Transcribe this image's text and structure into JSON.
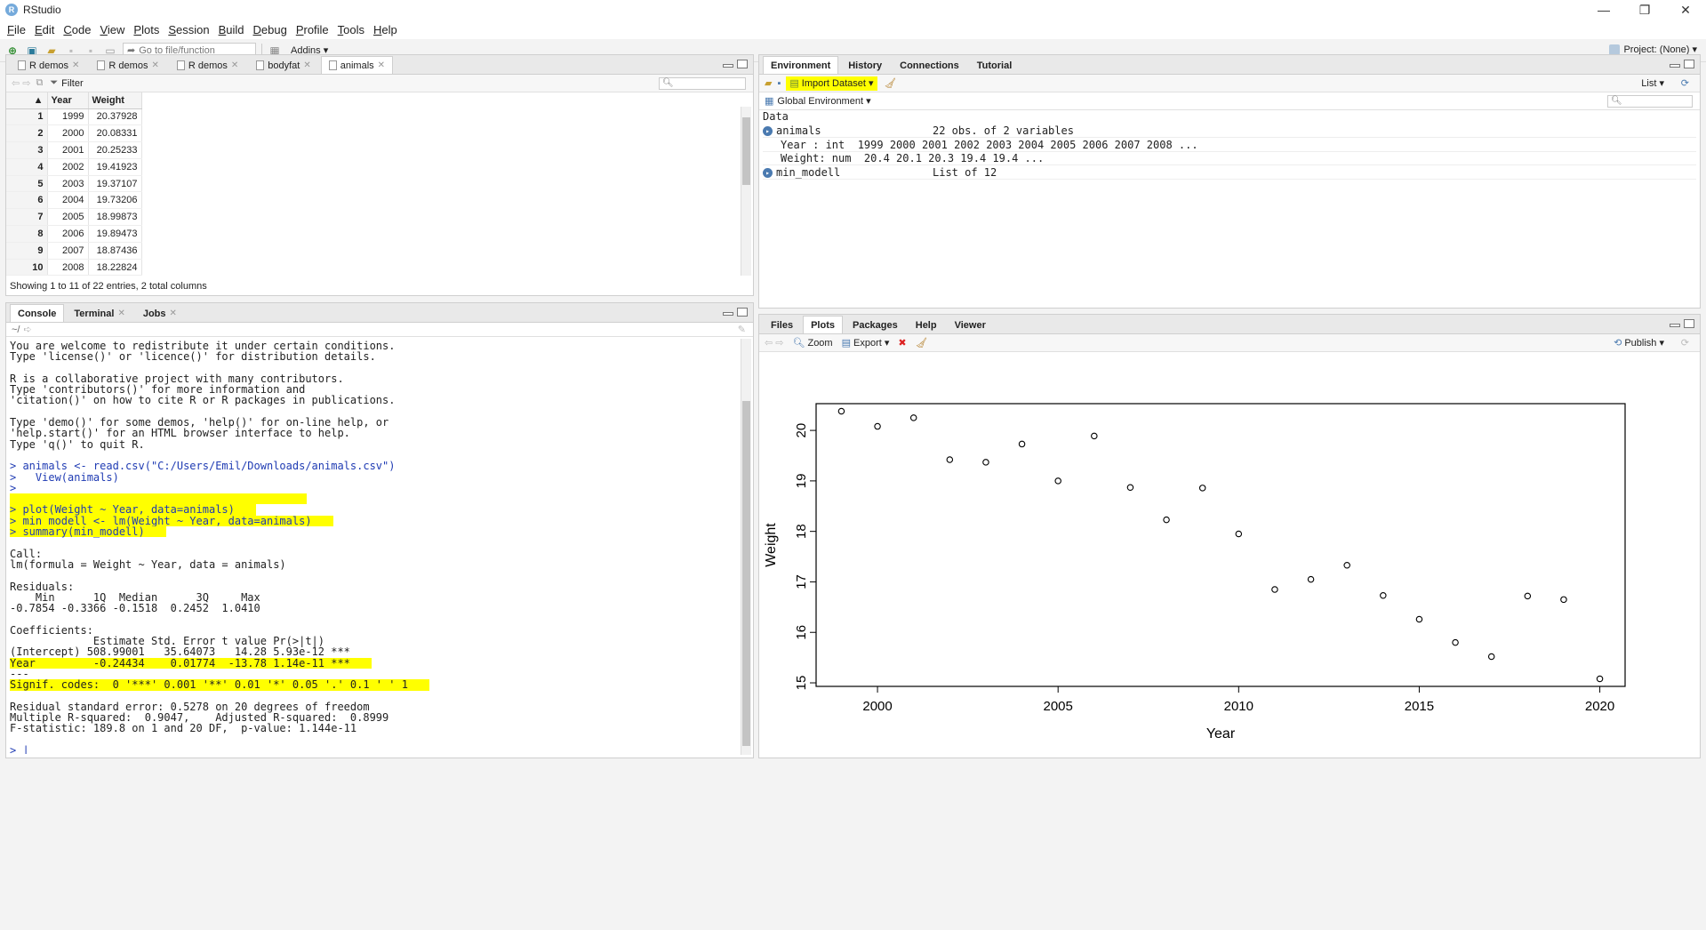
{
  "window": {
    "title": "RStudio",
    "controls": [
      "—",
      "❐",
      "✕"
    ]
  },
  "menu": [
    "File",
    "Edit",
    "Code",
    "View",
    "Plots",
    "Session",
    "Build",
    "Debug",
    "Profile",
    "Tools",
    "Help"
  ],
  "toolbar": {
    "goto_placeholder": "Go to file/function",
    "addins": "Addins ▾",
    "project": "Project: (None) ▾"
  },
  "source": {
    "tabs": [
      "R demos",
      "R demos",
      "R demos",
      "bodyfat",
      "animals"
    ],
    "filter_label": "Filter",
    "columns": [
      "Year",
      "Weight"
    ],
    "rows": [
      [
        "1",
        "1999",
        "20.37928"
      ],
      [
        "2",
        "2000",
        "20.08331"
      ],
      [
        "3",
        "2001",
        "20.25233"
      ],
      [
        "4",
        "2002",
        "19.41923"
      ],
      [
        "5",
        "2003",
        "19.37107"
      ],
      [
        "6",
        "2004",
        "19.73206"
      ],
      [
        "7",
        "2005",
        "18.99873"
      ],
      [
        "8",
        "2006",
        "19.89473"
      ],
      [
        "9",
        "2007",
        "18.87436"
      ],
      [
        "10",
        "2008",
        "18.22824"
      ]
    ],
    "status": "Showing 1 to 11 of 22 entries, 2 total columns"
  },
  "console": {
    "tabs": [
      "Console",
      "Terminal",
      "Jobs"
    ],
    "path": "~/",
    "lines": [
      {
        "t": "You are welcome to redistribute it under certain conditions.",
        "c": ""
      },
      {
        "t": "Type 'license()' or 'licence()' for distribution details.",
        "c": ""
      },
      {
        "t": "",
        "c": ""
      },
      {
        "t": "R is a collaborative project with many contributors.",
        "c": ""
      },
      {
        "t": "Type 'contributors()' for more information and",
        "c": ""
      },
      {
        "t": "'citation()' on how to cite R or R packages in publications.",
        "c": ""
      },
      {
        "t": "",
        "c": ""
      },
      {
        "t": "Type 'demo()' for some demos, 'help()' for on-line help, or",
        "c": ""
      },
      {
        "t": "'help.start()' for an HTML browser interface to help.",
        "c": ""
      },
      {
        "t": "Type 'q()' to quit R.",
        "c": ""
      },
      {
        "t": "",
        "c": ""
      },
      {
        "t": "> animals <- read.csv(\"C:/Users/Emil/Downloads/animals.csv\")",
        "c": "cmd"
      },
      {
        "t": ">   View(animals)",
        "c": "cmd"
      },
      {
        "t": ">",
        "c": "cmd"
      },
      {
        "t": "",
        "c": "hlbox"
      },
      {
        "t": "> plot(Weight ~ Year, data=animals)",
        "c": "cmd hl"
      },
      {
        "t": "> min_modell <- lm(Weight ~ Year, data=animals)",
        "c": "cmd hl"
      },
      {
        "t": "> summary(min_modell)",
        "c": "cmd hl"
      },
      {
        "t": "",
        "c": ""
      },
      {
        "t": "Call:",
        "c": ""
      },
      {
        "t": "lm(formula = Weight ~ Year, data = animals)",
        "c": ""
      },
      {
        "t": "",
        "c": ""
      },
      {
        "t": "Residuals:",
        "c": ""
      },
      {
        "t": "    Min      1Q  Median      3Q     Max ",
        "c": ""
      },
      {
        "t": "-0.7854 -0.3366 -0.1518  0.2452  1.0410 ",
        "c": ""
      },
      {
        "t": "",
        "c": ""
      },
      {
        "t": "Coefficients:",
        "c": ""
      },
      {
        "t": "             Estimate Std. Error t value Pr(>|t|)    ",
        "c": ""
      },
      {
        "t": "(Intercept) 508.99001   35.64073   14.28 5.93e-12 ***",
        "c": ""
      },
      {
        "t": "Year         -0.24434    0.01774  -13.78 1.14e-11 ***",
        "c": "hl"
      },
      {
        "t": "---",
        "c": ""
      },
      {
        "t": "Signif. codes:  0 '***' 0.001 '**' 0.01 '*' 0.05 '.' 0.1 ' ' 1",
        "c": "hl"
      },
      {
        "t": "",
        "c": ""
      },
      {
        "t": "Residual standard error: 0.5278 on 20 degrees of freedom",
        "c": ""
      },
      {
        "t": "Multiple R-squared:  0.9047,\tAdjusted R-squared:  0.8999 ",
        "c": ""
      },
      {
        "t": "F-statistic: 189.8 on 1 and 20 DF,  p-value: 1.144e-11",
        "c": ""
      },
      {
        "t": "",
        "c": ""
      },
      {
        "t": "> |",
        "c": "cmd"
      }
    ]
  },
  "environment": {
    "tabs": [
      "Environment",
      "History",
      "Connections",
      "Tutorial"
    ],
    "import_label": "Import Dataset ▾",
    "view_mode": "List ▾",
    "scope": "Global Environment ▾",
    "section": "Data",
    "objects": [
      {
        "name": "animals",
        "value": "22 obs. of 2 variables"
      },
      {
        "name": "",
        "value": "Year : int  1999 2000 2001 2002 2003 2004 2005 2006 2007 2008 ..."
      },
      {
        "name": "",
        "value": "Weight: num  20.4 20.1 20.3 19.4 19.4 ..."
      },
      {
        "name": "min_modell",
        "value": "List of 12"
      }
    ]
  },
  "plots_pane": {
    "tabs": [
      "Files",
      "Plots",
      "Packages",
      "Help",
      "Viewer"
    ],
    "zoom_label": "Zoom",
    "export_label": "Export ▾",
    "publish_label": "Publish ▾"
  },
  "chart_data": {
    "type": "scatter",
    "xlabel": "Year",
    "ylabel": "Weight",
    "xlim": [
      1998.3,
      2020.7
    ],
    "ylim": [
      14.93,
      20.53
    ],
    "xticks": [
      2000,
      2005,
      2010,
      2015,
      2020
    ],
    "yticks": [
      15,
      16,
      17,
      18,
      19,
      20
    ],
    "x": [
      1999,
      2000,
      2001,
      2002,
      2003,
      2004,
      2005,
      2006,
      2007,
      2008,
      2009,
      2010,
      2011,
      2012,
      2013,
      2014,
      2015,
      2016,
      2017,
      2018,
      2019,
      2020
    ],
    "y": [
      20.38,
      20.08,
      20.25,
      19.42,
      19.37,
      19.73,
      19.0,
      19.89,
      18.87,
      18.23,
      18.86,
      17.95,
      16.85,
      17.05,
      17.33,
      16.73,
      16.26,
      15.8,
      15.52,
      16.72,
      16.65,
      15.08
    ]
  }
}
